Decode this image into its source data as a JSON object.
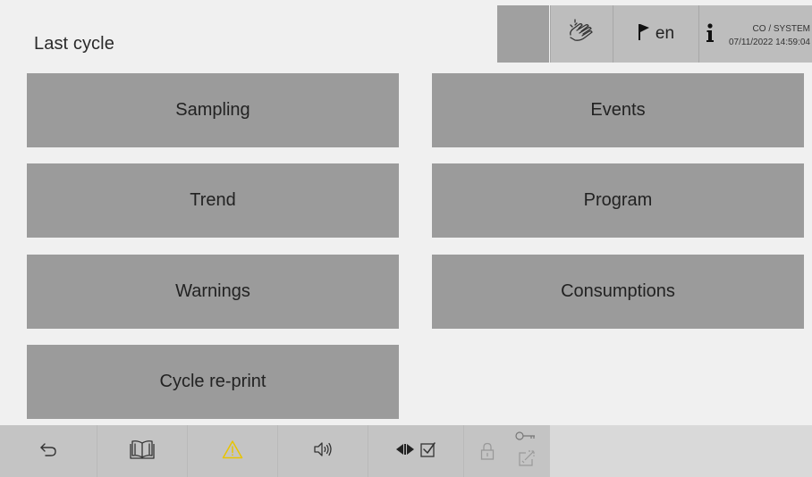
{
  "header": {
    "title": "Last cycle",
    "hand_icon": "touch-hand-icon",
    "language": "en",
    "flag_icon": "flag-icon",
    "info_icon": "info-icon",
    "user": "CO / SYSTEM",
    "datetime": "07/11/2022 14:59:04"
  },
  "menu": {
    "sampling": "Sampling",
    "events": "Events",
    "trend": "Trend",
    "program": "Program",
    "warnings": "Warnings",
    "consumptions": "Consumptions",
    "cycle_reprint": "Cycle re-print"
  },
  "bottombar": {
    "icons": [
      "back-arrow-icon",
      "manual-book-icon",
      "warning-icon",
      "speaker-icon",
      "compare-icon",
      "checkbox-icon",
      "lock-icon",
      "key-icon",
      "external-link-icon"
    ]
  },
  "colors": {
    "background": "#f0f0f0",
    "menu_button": "#9b9b9b",
    "header_cell": "#bdbdbd",
    "warning_accent": "#e8c400"
  }
}
